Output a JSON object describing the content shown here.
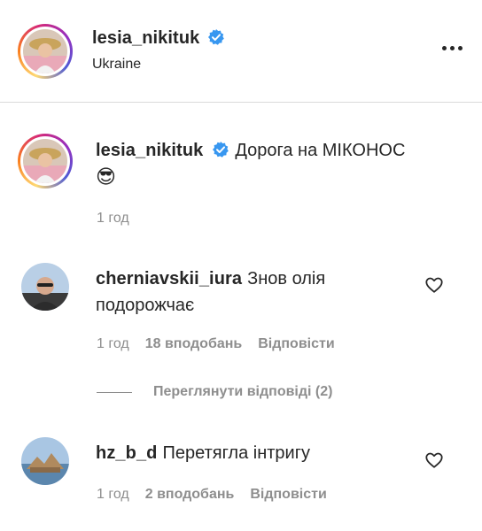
{
  "post_header": {
    "username": "lesia_nikituk",
    "location": "Ukraine"
  },
  "caption": {
    "username": "lesia_nikituk",
    "text": "Дорога на МІКОНОС",
    "emoji": "😎",
    "time": "1 год"
  },
  "comments": [
    {
      "username": "cherniavskii_iura",
      "text_line1": "Знов олія",
      "text_line2": "подорожчає",
      "time": "1 год",
      "likes": "18 вподобань",
      "reply_label": "Відповісти",
      "view_replies": "Переглянути відповіді (2)"
    },
    {
      "username": "hz_b_d",
      "text": "Перетягла інтригу",
      "time": "1 год",
      "likes": "2 вподобань",
      "reply_label": "Відповісти"
    }
  ],
  "icons": {
    "verified": "verified-badge-icon",
    "more": "more-options-icon",
    "like": "heart-outline-icon"
  },
  "colors": {
    "verified": "#3897f0",
    "text": "#262626",
    "secondary": "#8e8e8e",
    "divider": "#dbdbdb"
  }
}
